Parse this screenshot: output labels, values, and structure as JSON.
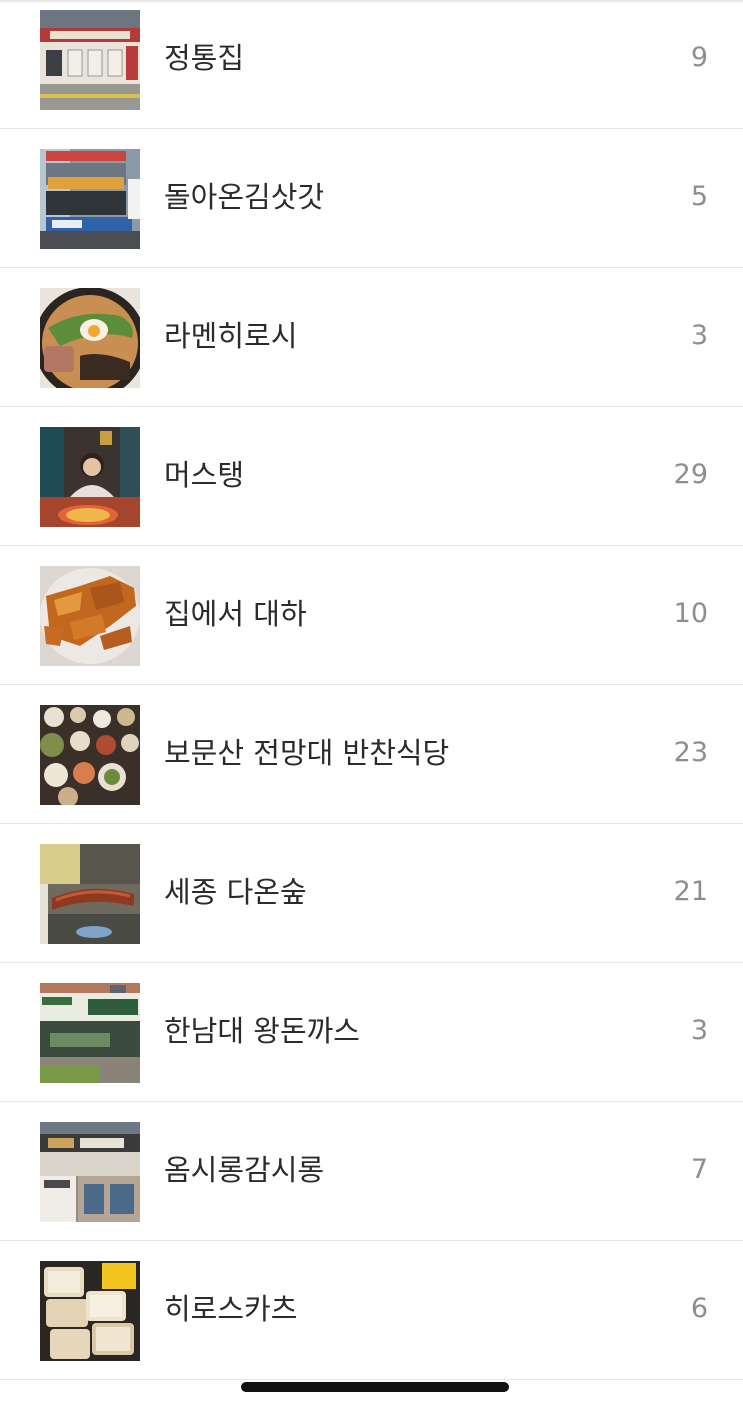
{
  "albums": [
    {
      "name": "정통집",
      "count": "9",
      "thumbnail": "restaurant-storefront-photo"
    },
    {
      "name": "돌아온김삿갓",
      "count": "5",
      "thumbnail": "building-signage-photo"
    },
    {
      "name": "라멘히로시",
      "count": "3",
      "thumbnail": "ramen-bowl-photo"
    },
    {
      "name": "머스탱",
      "count": "29",
      "thumbnail": "person-with-pizza-photo"
    },
    {
      "name": "집에서 대하",
      "count": "10",
      "thumbnail": "grilled-shrimp-photo"
    },
    {
      "name": "보문산 전망대 반찬식당",
      "count": "23",
      "thumbnail": "korean-side-dishes-photo"
    },
    {
      "name": "세종 다온숲",
      "count": "21",
      "thumbnail": "grilled-sausage-photo"
    },
    {
      "name": "한남대 왕돈까스",
      "count": "3",
      "thumbnail": "donkatsu-storefront-photo"
    },
    {
      "name": "옴시롱감시롱",
      "count": "7",
      "thumbnail": "shop-building-photo"
    },
    {
      "name": "히로스카츠",
      "count": "6",
      "thumbnail": "katsu-box-photo"
    }
  ]
}
